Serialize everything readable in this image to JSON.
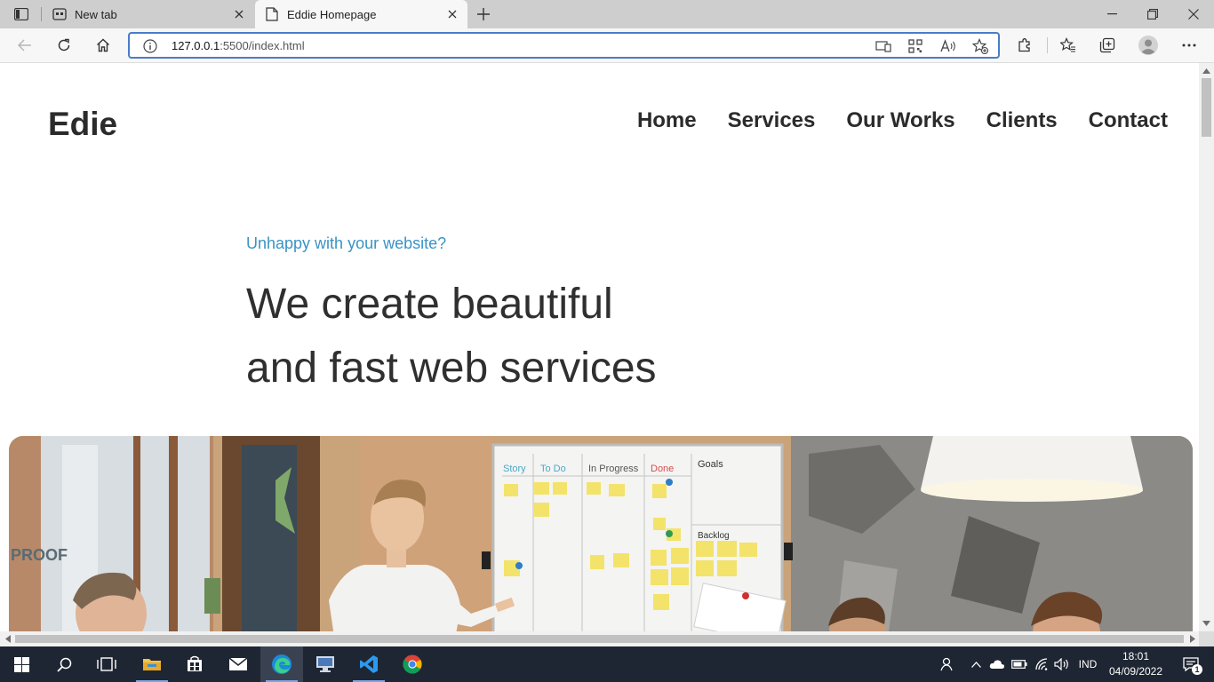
{
  "browser": {
    "tabs": [
      {
        "title": "New tab",
        "icon": "newtab-page-icon"
      },
      {
        "title": "Eddie Homepage",
        "icon": "page-icon"
      }
    ],
    "url_host": "127.0.0.1",
    "url_rest": ":5500/index.html"
  },
  "site": {
    "logo": "Edie",
    "menu": [
      "Home",
      "Services",
      "Our Works",
      "Clients",
      "Contact"
    ],
    "tagline": "Unhappy with your website?",
    "headline_line1": "We create beautiful",
    "headline_line2": "and fast web services",
    "hero_whiteboard": {
      "columns": [
        "Story",
        "To Do",
        "In Progress",
        "Done"
      ],
      "goals_title": "Goals",
      "backlog_title": "Backlog"
    },
    "hero_window_text": "PROOF"
  },
  "taskbar": {
    "language": "IND",
    "time": "18:01",
    "date": "04/09/2022",
    "notification_count": "1"
  },
  "colors": {
    "accent_link": "#3a93c4",
    "omnibox_border": "#4a7cc8",
    "taskbar": "#1f2633"
  }
}
